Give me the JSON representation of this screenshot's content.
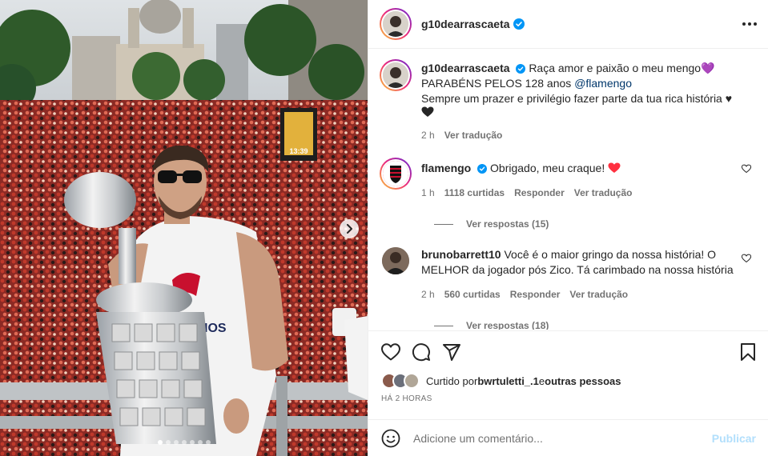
{
  "post": {
    "username": "g10dearrascaeta",
    "caption_line1": "Raça amor e paixão o meu mengo",
    "caption_emoji": "💜",
    "caption_line2_prefix": "PARABÉNS PELOS 128 anos ",
    "caption_mention": "@flamengo",
    "caption_line3": "Sempre um prazer e privilégio fazer parte da tua rica história",
    "caption_heart": "♥",
    "caption_time": "2 h",
    "caption_translate": "Ver tradução"
  },
  "photo": {
    "slide_count": 7,
    "active_slide": 1,
    "clock_text": "13:39"
  },
  "comments": [
    {
      "username": "flamengo",
      "text": "Obrigado, meu craque!",
      "time": "1 h",
      "likes": "1118 curtidas",
      "reply": "Responder",
      "translate": "Ver tradução",
      "view_replies": "Ver respostas (15)"
    },
    {
      "username": "brunobarrett10",
      "text": "Você é o maior gringo da nossa história! O MELHOR da jogador pós Zico. Tá carimbado na nossa história",
      "time": "2 h",
      "likes": "560 curtidas",
      "reply": "Responder",
      "translate": "Ver tradução",
      "view_replies": "Ver respostas (18)"
    }
  ],
  "likes": {
    "prefix": "Curtido por ",
    "user": "bwrtuletti_.1",
    "middle": " e ",
    "others": "outras pessoas"
  },
  "timestamp": "HÁ 2 HORAS",
  "add_comment": {
    "placeholder": "Adicione um comentário...",
    "publish_label": "Publicar"
  },
  "colors": {
    "verified": "#0095f6",
    "flamengo_red": "#c8102e",
    "heart_red": "#ff3040",
    "publish_disabled": "#b2dffc"
  },
  "icons": [
    "more-options-icon",
    "verified-badge-icon",
    "heart-icon",
    "comment-icon",
    "share-icon",
    "bookmark-icon",
    "emoji-icon",
    "chevron-right-icon"
  ]
}
